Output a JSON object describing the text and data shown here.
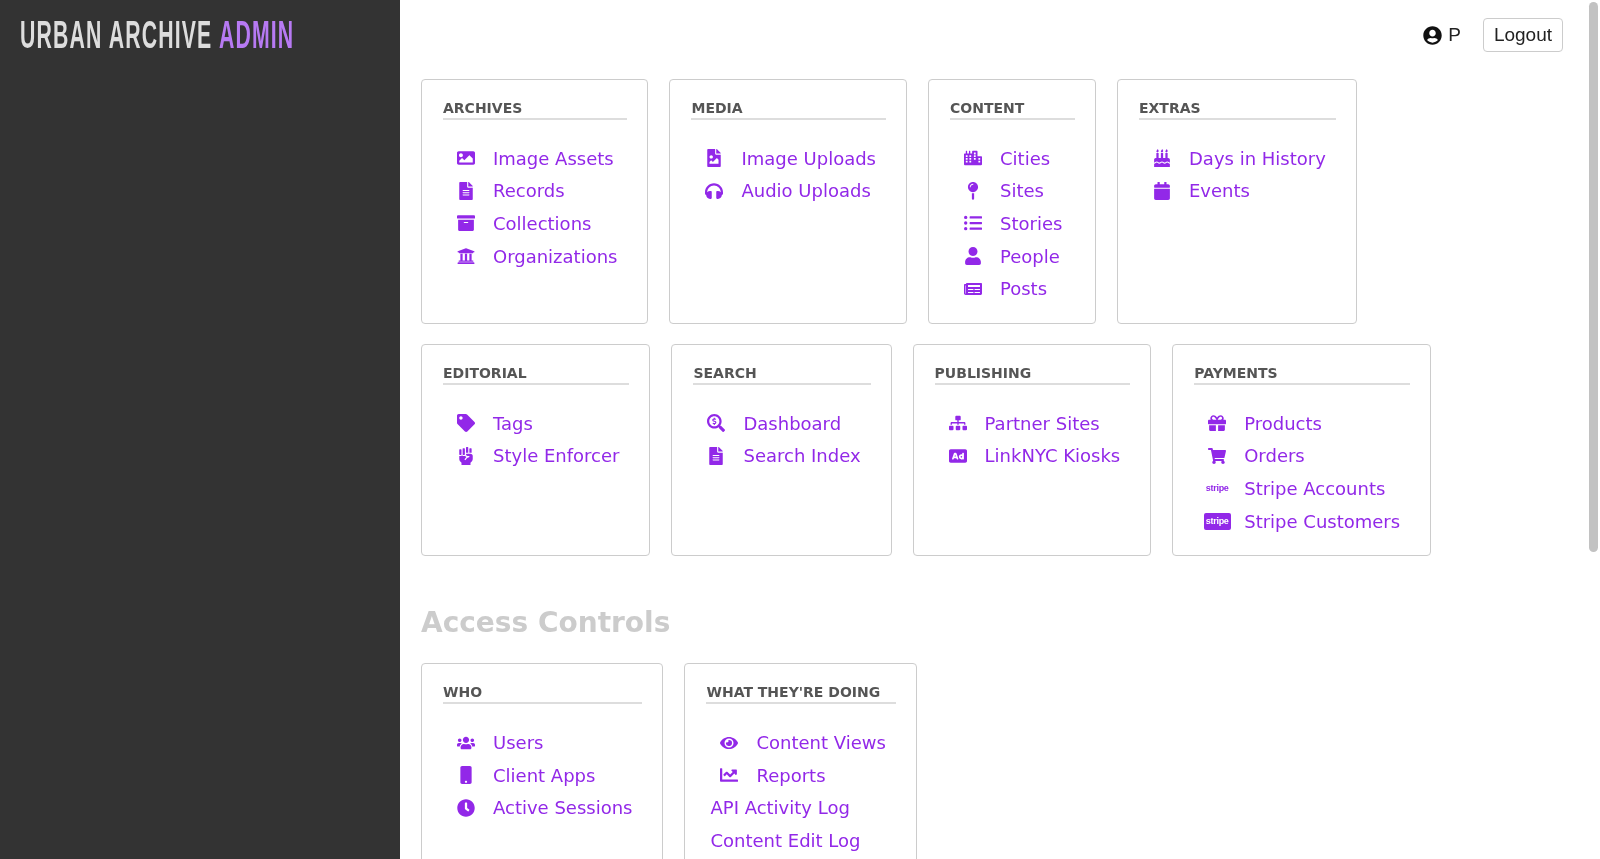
{
  "brand": {
    "name": "URBAN ARCHIVE",
    "suffix": "ADMIN"
  },
  "user": {
    "initial": "P"
  },
  "logout": "Logout",
  "groups": [
    {
      "cards": [
        {
          "title": "ARCHIVES",
          "items": [
            {
              "label": "Image Assets",
              "kind": "icon"
            },
            {
              "label": "Records",
              "kind": "icon"
            },
            {
              "label": "Collections",
              "kind": "icon"
            },
            {
              "label": "Organizations",
              "kind": "icon"
            }
          ]
        },
        {
          "title": "MEDIA",
          "items": [
            {
              "label": "Image Uploads",
              "kind": "icon"
            },
            {
              "label": "Audio Uploads",
              "kind": "icon"
            }
          ]
        },
        {
          "title": "CONTENT",
          "items": [
            {
              "label": "Cities",
              "kind": "icon"
            },
            {
              "label": "Sites",
              "kind": "icon"
            },
            {
              "label": "Stories",
              "kind": "icon"
            },
            {
              "label": "People",
              "kind": "icon"
            },
            {
              "label": "Posts",
              "kind": "icon"
            }
          ]
        },
        {
          "title": "EXTRAS",
          "items": [
            {
              "label": "Days in History",
              "kind": "icon"
            },
            {
              "label": "Events",
              "kind": "icon"
            }
          ]
        }
      ]
    },
    {
      "cards": [
        {
          "title": "EDITORIAL",
          "items": [
            {
              "label": "Tags",
              "kind": "icon"
            },
            {
              "label": "Style Enforcer",
              "kind": "icon"
            }
          ]
        },
        {
          "title": "SEARCH",
          "items": [
            {
              "label": "Dashboard",
              "kind": "icon"
            },
            {
              "label": "Search Index",
              "kind": "icon"
            }
          ]
        },
        {
          "title": "PUBLISHING",
          "items": [
            {
              "label": "Partner Sites",
              "kind": "icon"
            },
            {
              "label": "LinkNYC Kiosks",
              "kind": "icon"
            }
          ]
        },
        {
          "title": "PAYMENTS",
          "items": [
            {
              "label": "Products",
              "kind": "icon"
            },
            {
              "label": "Orders",
              "kind": "icon"
            },
            {
              "label": "Stripe Accounts",
              "kind": "logo",
              "logo": "stripe"
            },
            {
              "label": "Stripe Customers",
              "kind": "logo-box",
              "logo": "stripe"
            }
          ]
        }
      ]
    },
    {
      "heading": "Access Controls",
      "cards": [
        {
          "title": "WHO",
          "items": [
            {
              "label": "Users",
              "kind": "icon"
            },
            {
              "label": "Client Apps",
              "kind": "icon"
            },
            {
              "label": "Active Sessions",
              "kind": "icon"
            }
          ]
        },
        {
          "title": "WHAT THEY'RE DOING",
          "items": [
            {
              "label": "Content Views",
              "kind": "icon"
            },
            {
              "label": "Reports",
              "kind": "icon"
            },
            {
              "label": "API Activity Log",
              "kind": "text"
            },
            {
              "label": "Content Edit Log",
              "kind": "text"
            }
          ]
        }
      ]
    }
  ]
}
